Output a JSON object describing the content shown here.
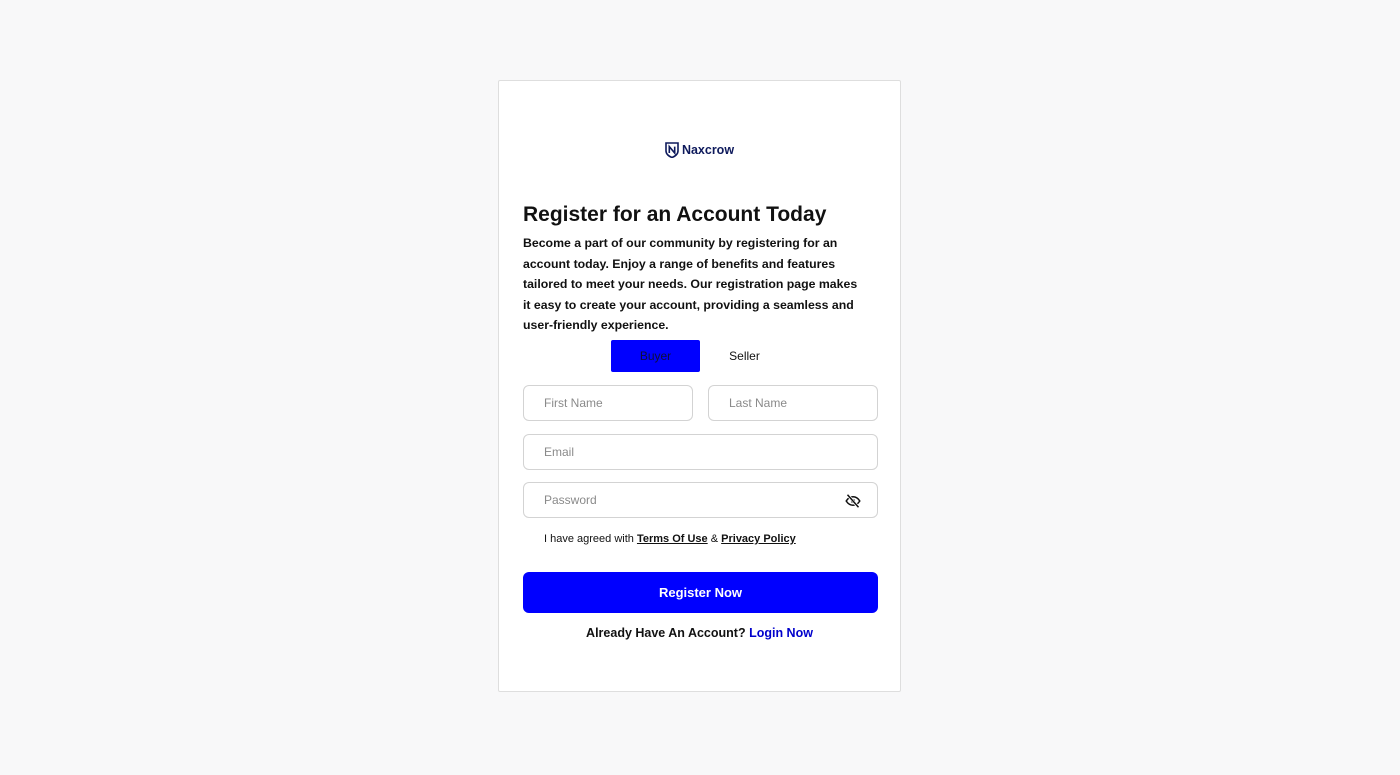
{
  "brand": {
    "name": "Naxcrow",
    "icon": "shield-n-logo-icon",
    "color": "#0e1a5c"
  },
  "heading": {
    "title": "Register for an Account Today",
    "description": "Become a part of our community by registering for an account today. Enjoy a range of benefits and features tailored to meet your needs. Our registration page makes it easy to create your account, providing a seamless and user-friendly experience."
  },
  "tabs": [
    {
      "label": "Buyer",
      "active": true
    },
    {
      "label": "Seller",
      "active": false
    }
  ],
  "form": {
    "first_name": {
      "placeholder": "First Name",
      "value": ""
    },
    "last_name": {
      "placeholder": "Last Name",
      "value": ""
    },
    "email": {
      "placeholder": "Email",
      "value": ""
    },
    "password": {
      "placeholder": "Password",
      "value": "",
      "toggle_icon": "eye-off-icon"
    },
    "agreement": {
      "prefix": "I have agreed with",
      "terms_label": "Terms Of Use",
      "separator": "&",
      "privacy_label": "Privacy Policy"
    },
    "submit_label": "Register Now"
  },
  "footer": {
    "prompt": "Already Have An Account?",
    "login_label": "Login Now"
  },
  "colors": {
    "accent": "#0000ff",
    "link": "#0000cc",
    "background": "#f8f8f9"
  }
}
